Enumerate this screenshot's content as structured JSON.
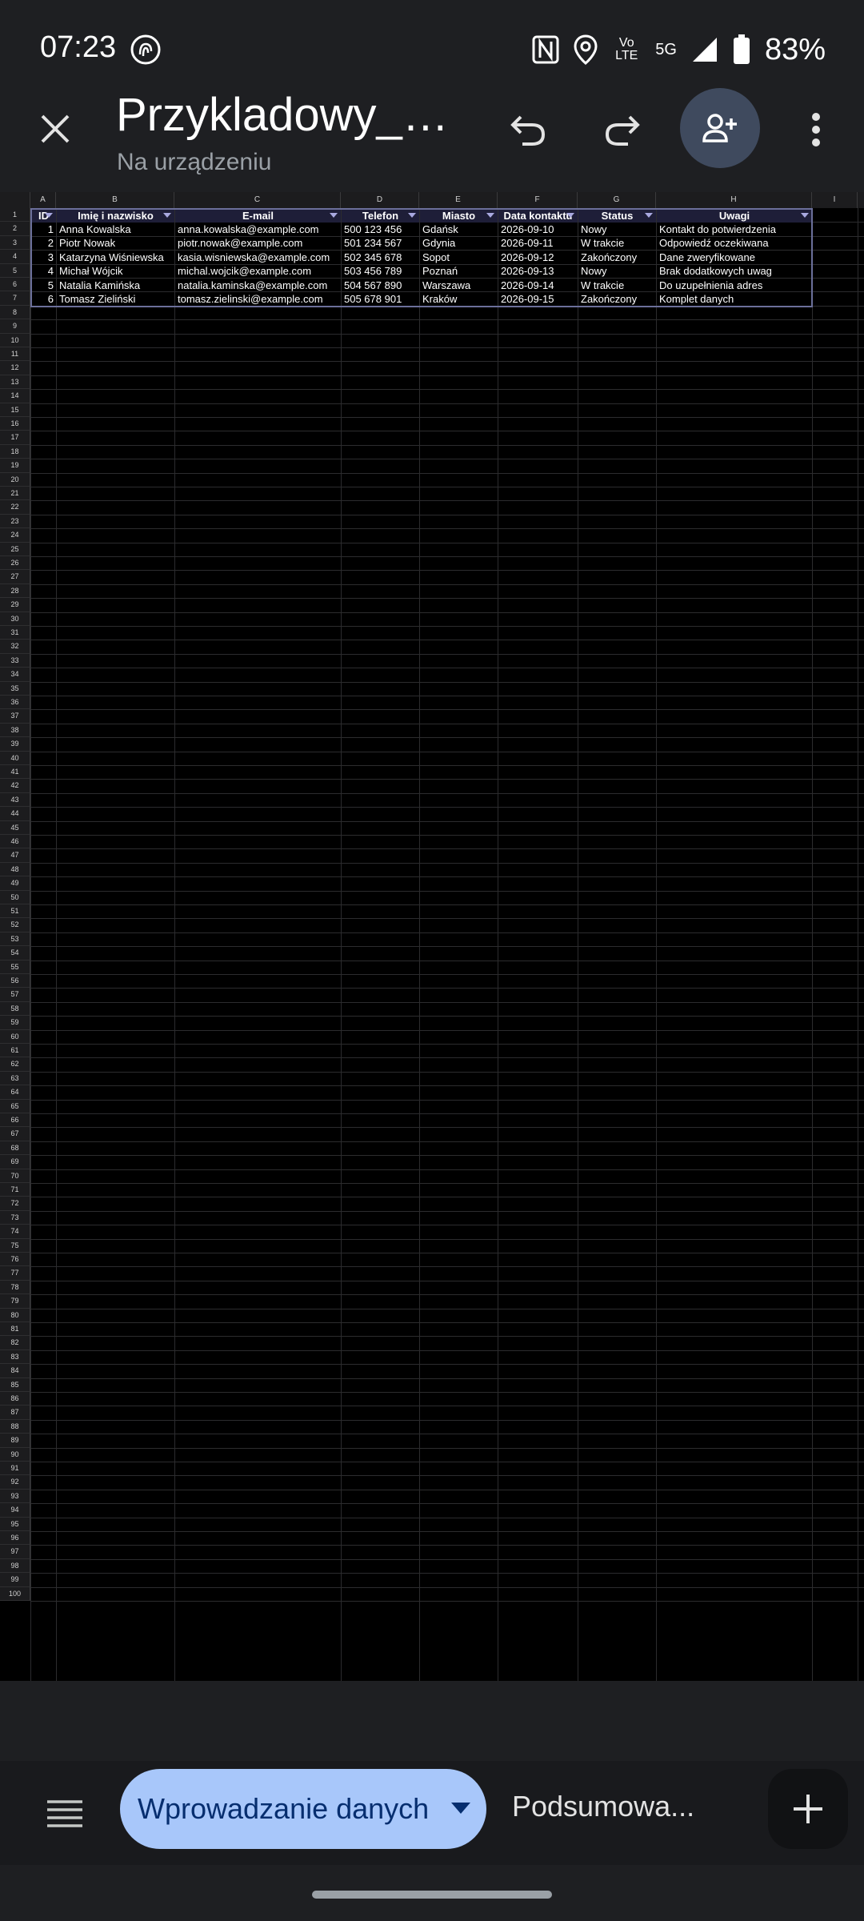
{
  "status_bar": {
    "time": "07:23",
    "network_labels": [
      "Vo LTE",
      "5G"
    ],
    "battery_percent": "83%",
    "icons": [
      "fingerprint-icon",
      "nfc-icon",
      "location-icon",
      "volte-icon",
      "5g-icon",
      "signal-icon",
      "battery-icon"
    ]
  },
  "app_bar": {
    "title": "Przykladowy_ar...",
    "subtitle": "Na urządzeniu",
    "icons": [
      "close-icon",
      "undo-icon",
      "redo-icon",
      "person-add-icon",
      "more-vert-icon"
    ]
  },
  "sheet": {
    "column_letters": [
      "A",
      "B",
      "C",
      "D",
      "E",
      "F",
      "G",
      "H",
      "I"
    ],
    "headers": [
      "ID",
      "Imię i nazwisko",
      "E-mail",
      "Telefon",
      "Miasto",
      "Data kontaktu",
      "Status",
      "Uwagi"
    ],
    "rows": [
      [
        "1",
        "Anna Kowalska",
        "anna.kowalska@example.com",
        "500 123 456",
        "Gdańsk",
        "2026-09-10",
        "Nowy",
        "Kontakt do potwierdzenia"
      ],
      [
        "2",
        "Piotr Nowak",
        "piotr.nowak@example.com",
        "501 234 567",
        "Gdynia",
        "2026-09-11",
        "W trakcie",
        "Odpowiedź oczekiwana"
      ],
      [
        "3",
        "Katarzyna Wiśniewska",
        "kasia.wisniewska@example.com",
        "502 345 678",
        "Sopot",
        "2026-09-12",
        "Zakończony",
        "Dane zweryfikowane"
      ],
      [
        "4",
        "Michał Wójcik",
        "michal.wojcik@example.com",
        "503 456 789",
        "Poznań",
        "2026-09-13",
        "Nowy",
        "Brak dodatkowych uwag"
      ],
      [
        "5",
        "Natalia Kamińska",
        "natalia.kaminska@example.com",
        "504 567 890",
        "Warszawa",
        "2026-09-14",
        "W trakcie",
        "Do uzupełnienia adres"
      ],
      [
        "6",
        "Tomasz Zieliński",
        "tomasz.zielinski@example.com",
        "505 678 901",
        "Kraków",
        "2026-09-15",
        "Zakończony",
        "Komplet danych"
      ]
    ],
    "row_count": 100
  },
  "tabs": {
    "active": "Wprowadzanie danych",
    "inactive": "Podsumowa..."
  },
  "colors": {
    "background": "#1e1f22",
    "grid": "#000000",
    "active_tab": "#a8c7fa",
    "share_button": "#3f4a5e",
    "header_fill": "#1e1e38"
  }
}
